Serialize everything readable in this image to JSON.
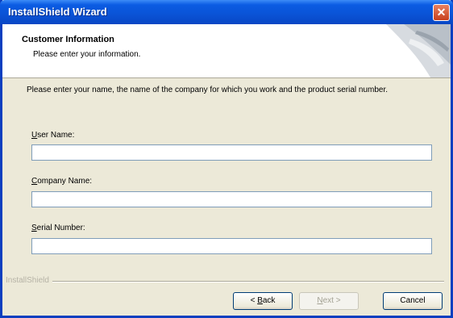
{
  "window": {
    "title": "InstallShield Wizard",
    "close_glyph": "✕"
  },
  "header": {
    "title": "Customer Information",
    "subtitle": "Please enter your information."
  },
  "instruction": "Please enter your name, the name of the company for which you work and the product serial number.",
  "fields": {
    "user_name": {
      "label_mnemonic": "U",
      "label_rest": "ser Name:",
      "value": ""
    },
    "company_name": {
      "label_mnemonic": "C",
      "label_rest": "ompany Name:",
      "value": ""
    },
    "serial_number": {
      "label_mnemonic": "S",
      "label_rest": "erial Number:",
      "value": ""
    }
  },
  "footer": {
    "brand": "InstallShield"
  },
  "buttons": {
    "back": {
      "prefix": "< ",
      "mnemonic": "B",
      "rest": "ack"
    },
    "next": {
      "mnemonic": "N",
      "rest": "ext >"
    },
    "cancel": {
      "label": "Cancel"
    }
  },
  "colors": {
    "titlebar": "#0a53d6",
    "close": "#c7401d",
    "face": "#ece9d8"
  }
}
